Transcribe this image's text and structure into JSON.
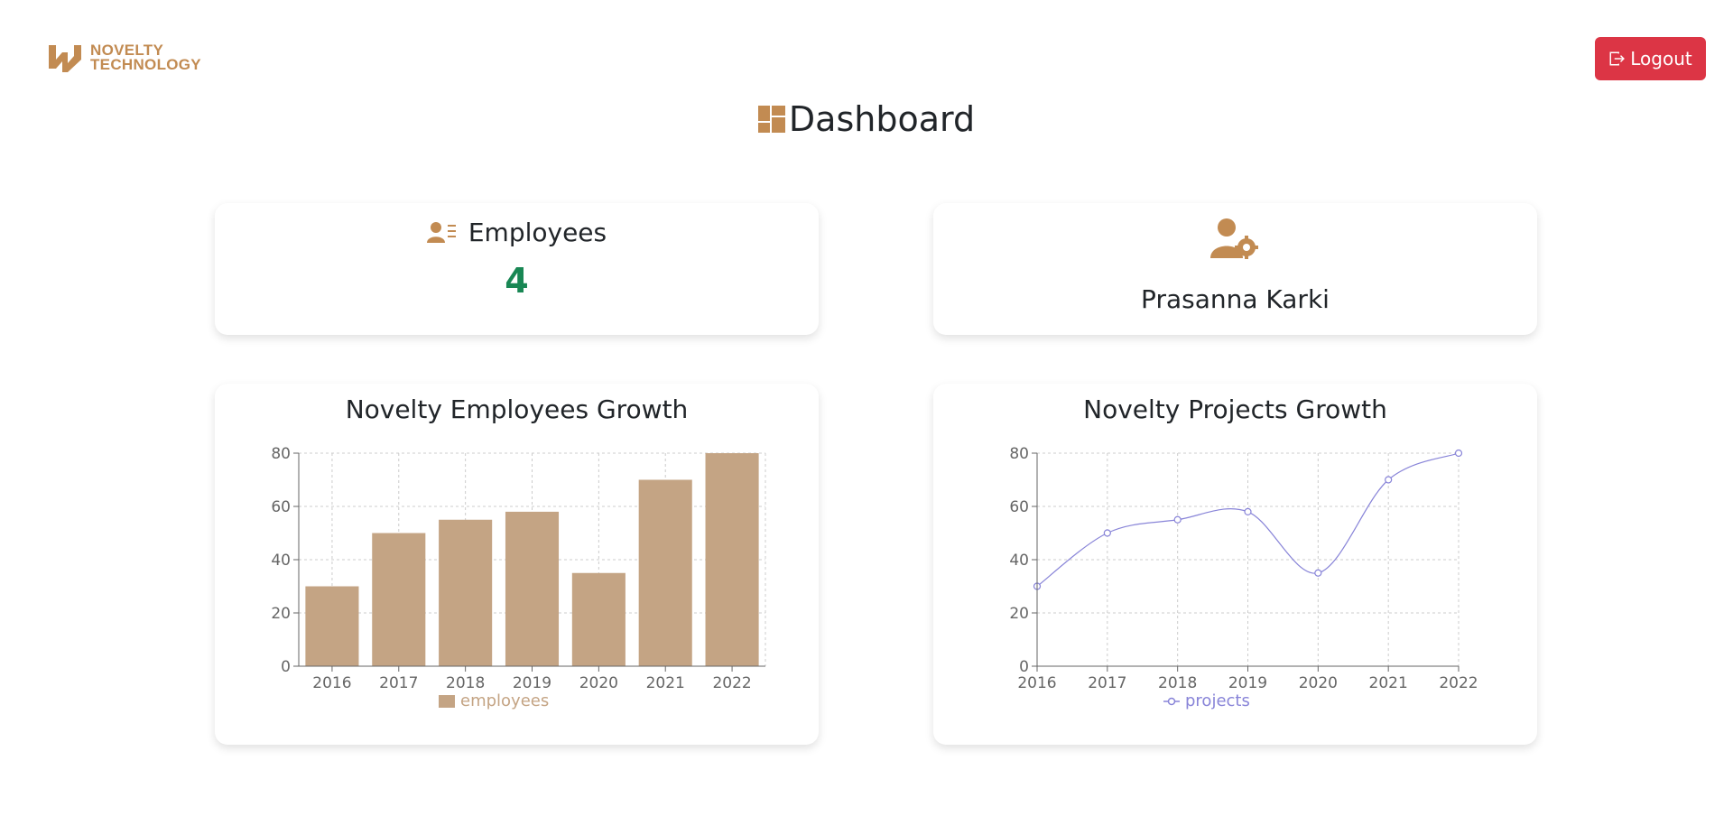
{
  "brand": {
    "line1": "NOVELTY",
    "line2": "TECHNOLOGY",
    "color": "#c28b52"
  },
  "header": {
    "logout_label": "Logout",
    "logout_color": "#dc3545"
  },
  "page": {
    "title": "Dashboard",
    "accent": "#c28b52"
  },
  "employees_card": {
    "label": "Employees",
    "count": "4",
    "count_color": "#198754"
  },
  "user_card": {
    "name": "Prasanna Karki"
  },
  "charts": {
    "bar": {
      "title": "Novelty Employees Growth",
      "legend": "employees"
    },
    "line": {
      "title": "Novelty Projects Growth",
      "legend": "projects"
    }
  },
  "chart_data": [
    {
      "type": "bar",
      "title": "Novelty Employees Growth",
      "categories": [
        "2016",
        "2017",
        "2018",
        "2019",
        "2020",
        "2021",
        "2022"
      ],
      "series": [
        {
          "name": "employees",
          "values": [
            30,
            50,
            55,
            58,
            35,
            70,
            80
          ],
          "color": "#c4a484"
        }
      ],
      "yticks": [
        0,
        20,
        40,
        60,
        80
      ],
      "ylim": [
        0,
        80
      ],
      "grid": true,
      "legend_position": "bottom"
    },
    {
      "type": "line",
      "title": "Novelty Projects Growth",
      "categories": [
        "2016",
        "2017",
        "2018",
        "2019",
        "2020",
        "2021",
        "2022"
      ],
      "series": [
        {
          "name": "projects",
          "values": [
            30,
            50,
            55,
            58,
            35,
            70,
            80
          ],
          "color": "#8884d8"
        }
      ],
      "yticks": [
        0,
        20,
        40,
        60,
        80
      ],
      "ylim": [
        0,
        80
      ],
      "grid": true,
      "legend_position": "bottom"
    }
  ]
}
